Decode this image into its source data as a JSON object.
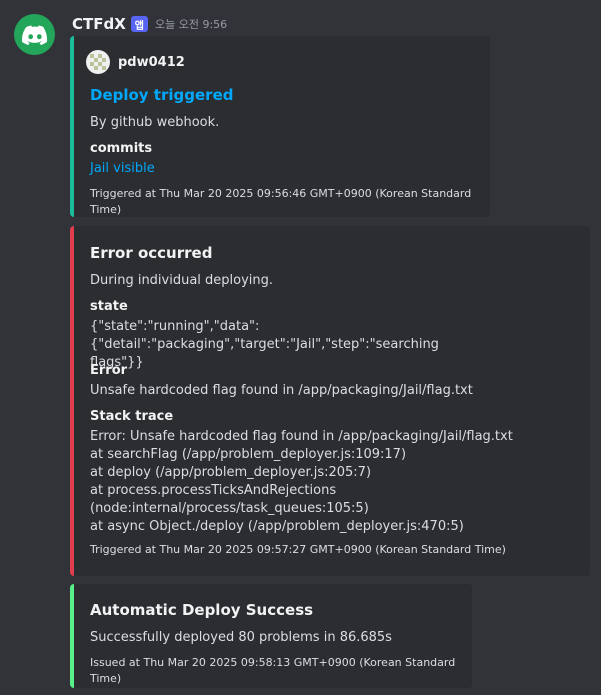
{
  "message": {
    "author": "CTFdX",
    "app_badge": "앱",
    "timestamp": "오늘 오전 9:56"
  },
  "embeds": [
    {
      "color": "#1abc9c",
      "author": "pdw0412",
      "title": "Deploy triggered",
      "description": "By github webhook.",
      "fields": [
        {
          "name": "commits",
          "value": "Jail visible"
        }
      ],
      "footer": "Triggered at Thu Mar 20 2025 09:56:46 GMT+0900 (Korean Standard Time)"
    },
    {
      "color": "#e03e4f",
      "title": "Error occurred",
      "description": "During individual deploying.",
      "fields": [
        {
          "name": "state",
          "value": "{\"state\":\"running\",\"data\":{\"detail\":\"packaging\",\"target\":\"Jail\",\"step\":\"searching\nflags\"}}"
        },
        {
          "name": "Error",
          "value": "Unsafe hardcoded flag found in /app/packaging/Jail/flag.txt"
        },
        {
          "name": "Stack trace",
          "value": "Error: Unsafe hardcoded flag found in /app/packaging/Jail/flag.txt\nat searchFlag (/app/problem_deployer.js:109:17)\nat deploy (/app/problem_deployer.js:205:7)\nat process.processTicksAndRejections\n(node:internal/process/task_queues:105:5)\nat async Object./deploy (/app/problem_deployer.js:470:5)"
        }
      ],
      "footer": "Triggered at Thu Mar 20 2025 09:57:27 GMT+0900 (Korean Standard Time)"
    },
    {
      "color": "#57f287",
      "title": "Automatic Deploy Success",
      "description": "Successfully deployed 80 problems in 86.685s",
      "footer": "Issued at Thu Mar 20 2025 09:58:13 GMT+0900 (Korean Standard Time)"
    }
  ]
}
